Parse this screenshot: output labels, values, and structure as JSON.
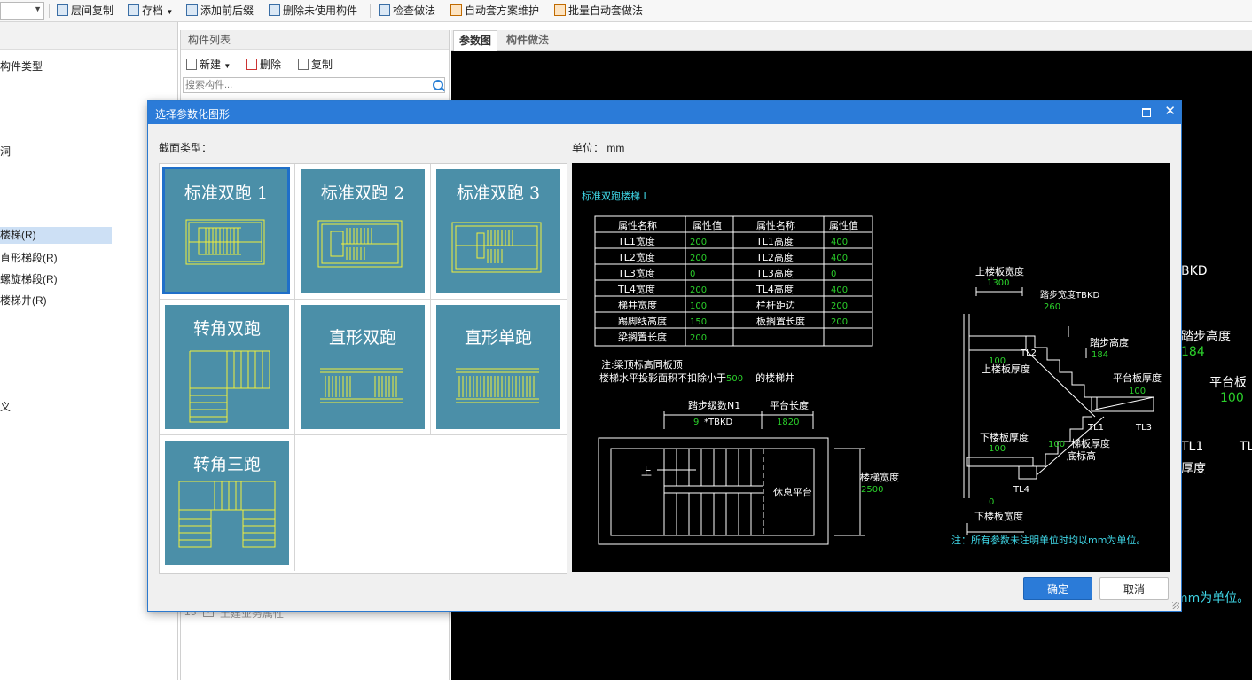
{
  "toolbar": {
    "items": [
      "层间复制",
      "存档",
      "添加前后缀",
      "删除未使用构件",
      "检查做法",
      "自动套方案维护",
      "批量自动套做法"
    ]
  },
  "left_tree": {
    "header": "构件类型",
    "items": [
      "洞",
      "楼梯(R)",
      "直形梯段(R)",
      "螺旋梯段(R)",
      "楼梯井(R)",
      "义"
    ]
  },
  "component_list": {
    "title": "构件列表",
    "new_label": "新建",
    "delete_label": "删除",
    "copy_label": "复制",
    "search_placeholder": "搜索构件...",
    "property_row_index": "15",
    "property_row_label": "土建业务属性"
  },
  "right_panel": {
    "tabs": [
      "参数图",
      "构件做法"
    ],
    "bg_labels": [
      "BKD",
      "踏步高度",
      "184",
      "平台板",
      "100",
      "TL1",
      "TL",
      "厚度",
      "mm为单位。"
    ]
  },
  "dialog": {
    "title": "选择参数化图形",
    "section_label": "截面类型：",
    "unit_label": "单位：",
    "unit_value": "mm",
    "ok_label": "确定",
    "cancel_label": "取消",
    "shapes": [
      "标准双跑 1",
      "标准双跑 2",
      "标准双跑 3",
      "转角双跑",
      "直形双跑",
      "直形单跑",
      "转角三跑"
    ],
    "selected_shape": "标准双跑 1"
  },
  "preview": {
    "title": "标准双跑楼梯 I",
    "table_headers": [
      "属性名称",
      "属性值",
      "属性名称",
      "属性值"
    ],
    "table_rows": [
      [
        "TL1宽度",
        "200",
        "TL1高度",
        "400"
      ],
      [
        "TL2宽度",
        "200",
        "TL2高度",
        "400"
      ],
      [
        "TL3宽度",
        "0",
        "TL3高度",
        "0"
      ],
      [
        "TL4宽度",
        "200",
        "TL4高度",
        "400"
      ],
      [
        "梯井宽度",
        "100",
        "栏杆距边",
        "200"
      ],
      [
        "踢脚线高度",
        "150",
        "板搁置长度",
        "200"
      ],
      [
        "梁搁置长度",
        "200",
        "",
        ""
      ]
    ],
    "note1": "注:梁顶标高同板顶",
    "note2_prefix": "楼梯水平投影面积不扣除小于",
    "note2_value": "500",
    "note2_suffix": "的楼梯井",
    "plan": {
      "steps_label": "踏步级数N1",
      "steps_value": "9",
      "steps_suffix": "*TBKD",
      "platform_label": "平台长度",
      "platform_value": "1820",
      "up_label": "上",
      "rest_label": "休息平台",
      "width_label": "楼梯宽度",
      "width_value": "2500"
    },
    "section": {
      "upper_width_label": "上楼板宽度",
      "upper_width_value": "1300",
      "tread_label": "踏步宽度TBKD",
      "tread_value": "260",
      "riser_label": "踏步高度",
      "riser_value": "184",
      "upper_thick_label": "上楼板厚度",
      "upper_thick_value": "100",
      "platform_thick_label": "平台板厚度",
      "platform_thick_value": "100",
      "lower_thick_label": "下楼板厚度",
      "lower_thick_value": "100",
      "slab_thick_label": "梯板厚度",
      "slab_thick_value": "100",
      "bottom_label": "底标高",
      "lower_width_label": "下楼板宽度",
      "lower_width_value": "0",
      "tl_labels": [
        "TL2",
        "TL1",
        "TL3",
        "TL4"
      ]
    },
    "footer_note": "注：所有参数未注明单位时均以mm为单位。"
  },
  "colors": {
    "accent": "#2b7bd8",
    "thumb_bg": "#4b8fa8",
    "cad_white": "#ffffff",
    "cad_green": "#2bd12b",
    "cad_cyan": "#3fd6e6",
    "cad_yellow": "#f2ef3a"
  }
}
